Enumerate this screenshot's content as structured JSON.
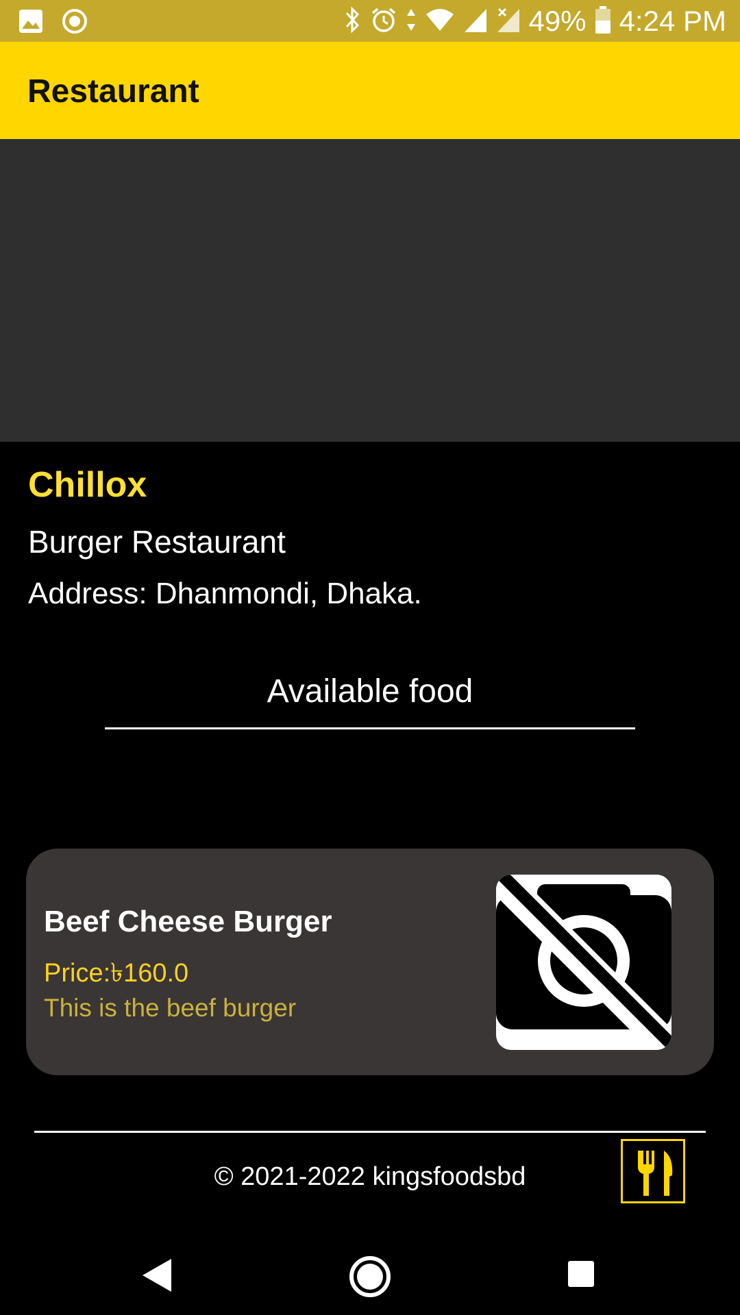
{
  "status_bar": {
    "battery": "49%",
    "time": "4:24 PM",
    "icons": [
      "image-icon",
      "record-icon",
      "bluetooth-icon",
      "alarm-icon",
      "data-arrows-icon",
      "wifi-icon",
      "signal-icon",
      "signal-no-data-icon",
      "battery-icon"
    ]
  },
  "app_bar": {
    "title": "Restaurant"
  },
  "restaurant": {
    "name": "Chillox",
    "type": "Burger Restaurant",
    "address": "Address: Dhanmondi, Dhaka."
  },
  "section": {
    "title": "Available food"
  },
  "foods": [
    {
      "name": "Beef Cheese Burger",
      "price": "Price:৳160.0",
      "description": "This is the beef burger",
      "image_icon": "no-photo-icon"
    }
  ],
  "footer": {
    "text": "© 2021-2022 kingsfoodsbd",
    "logo_icon": "fork-knife-icon"
  },
  "nav": {
    "icons": [
      "back-icon",
      "home-icon",
      "recents-icon"
    ]
  },
  "colors": {
    "status_bar": "#C4A92C",
    "app_bar": "#FFD600",
    "accent": "#FFE033",
    "card": "#3A3636",
    "hero": "#2F2F2F"
  }
}
